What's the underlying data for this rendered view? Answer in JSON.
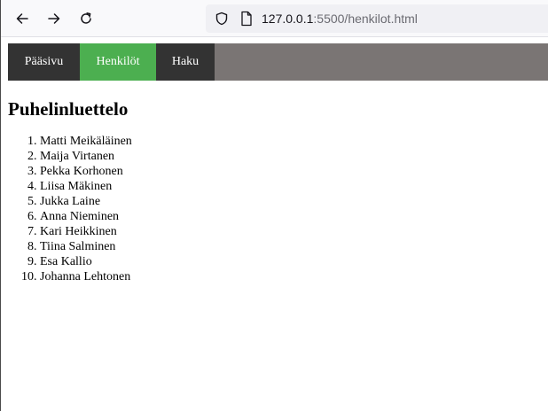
{
  "browser": {
    "url_host": "127.0.0.1",
    "url_rest": ":5500/henkilot.html",
    "icons": {
      "back": "arrow-left-icon",
      "forward": "arrow-right-icon",
      "reload": "reload-icon",
      "security": "shield-icon",
      "page": "page-icon"
    }
  },
  "nav": {
    "items": [
      {
        "label": "Pääsivu",
        "active": false
      },
      {
        "label": "Henkilöt",
        "active": true
      },
      {
        "label": "Haku",
        "active": false
      }
    ],
    "colors": {
      "bar": "#7a7574",
      "item": "#333333",
      "active": "#4caf50",
      "text": "#ffffff"
    }
  },
  "page": {
    "title": "Puhelinluettelo",
    "people": [
      "Matti Meikäläinen",
      "Maija Virtanen",
      "Pekka Korhonen",
      "Liisa Mäkinen",
      "Jukka Laine",
      "Anna Nieminen",
      "Kari Heikkinen",
      "Tiina Salminen",
      "Esa Kallio",
      "Johanna Lehtonen"
    ]
  }
}
